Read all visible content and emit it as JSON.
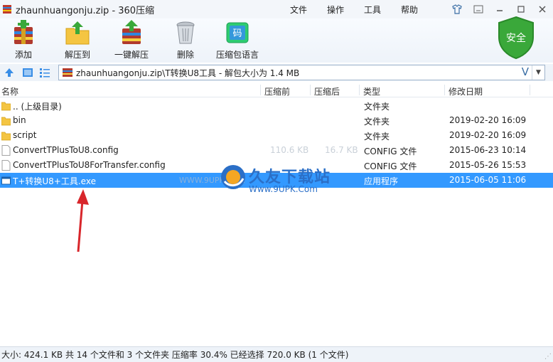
{
  "window": {
    "title": "zhaunhuangonju.zip - 360压缩",
    "menu": [
      "文件",
      "操作",
      "工具",
      "帮助"
    ],
    "controls": [
      "skin-icon",
      "minimize-to-tray-icon",
      "minimize-icon",
      "maximize-icon",
      "close-icon"
    ]
  },
  "toolbar": {
    "add": "添加",
    "extract_to": "解压到",
    "one_click_extract": "一键解压",
    "delete": "删除",
    "archive_language": "压缩包语言",
    "security_badge": "安全"
  },
  "addressbar": {
    "path": "zhaunhuangonju.zip\\T转换U8工具 - 解包大小为 1.4 MB"
  },
  "columns": {
    "name": "名称",
    "compressed_before": "压缩前",
    "compressed_after": "压缩后",
    "type": "类型",
    "modified": "修改日期"
  },
  "files": [
    {
      "name": ".. (上级目录)",
      "size_before": "",
      "size_after": "",
      "type": "文件夹",
      "modified": "",
      "icon": "folder"
    },
    {
      "name": "bin",
      "size_before": "",
      "size_after": "",
      "type": "文件夹",
      "modified": "2019-02-20 16:09",
      "icon": "folder"
    },
    {
      "name": "script",
      "size_before": "",
      "size_after": "",
      "type": "文件夹",
      "modified": "2019-02-20 16:09",
      "icon": "folder"
    },
    {
      "name": "ConvertTPlusToU8.config",
      "size_before": "110.6 KB",
      "size_after": "16.7 KB",
      "type": "CONFIG 文件",
      "modified": "2015-06-23 10:14",
      "icon": "file"
    },
    {
      "name": "ConvertTPlusToU8ForTransfer.config",
      "size_before": "",
      "size_after": "",
      "type": "CONFIG 文件",
      "modified": "2015-05-26 15:53",
      "icon": "file"
    },
    {
      "name": "T+转换U8+工具.exe",
      "size_before": "",
      "size_after": "",
      "type": "应用程序",
      "modified": "2015-06-05 11:06",
      "icon": "exe",
      "selected": true
    }
  ],
  "watermark": {
    "url_left": "WWW.9UPK.COM",
    "brand": "久友下载站",
    "brand_url": "Www.9UPK.Com"
  },
  "status": {
    "text": "大小: 424.1 KB 共 14 个文件和 3 个文件夹 压缩率 30.4% 已经选择 720.0 KB (1 个文件)"
  },
  "colors": {
    "selection": "#3399ff",
    "accent": "#3a6ea5",
    "shield": "#3aa83a"
  }
}
